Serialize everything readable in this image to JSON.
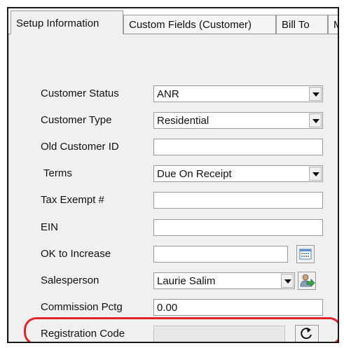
{
  "tabs": [
    {
      "label": "Setup Information",
      "active": true
    },
    {
      "label": "Custom Fields (Customer)",
      "active": false
    },
    {
      "label": "Bill To",
      "active": false
    },
    {
      "label": "Ma",
      "active": false
    }
  ],
  "form": {
    "customer_status": {
      "label": "Customer Status",
      "value": "ANR"
    },
    "customer_type": {
      "label": "Customer Type",
      "value": "Residential"
    },
    "old_customer_id": {
      "label": "Old Customer ID",
      "value": ""
    },
    "terms": {
      "label": "Terms",
      "value": "Due On Receipt"
    },
    "tax_exempt": {
      "label": "Tax Exempt #",
      "value": ""
    },
    "ein": {
      "label": "EIN",
      "value": ""
    },
    "ok_to_increase": {
      "label": "OK to Increase",
      "value": ""
    },
    "salesperson": {
      "label": "Salesperson",
      "value": "Laurie Salim"
    },
    "commission_pctg": {
      "label": "Commission Pctg",
      "value": "0.00"
    },
    "registration_code": {
      "label": "Registration Code",
      "value": ""
    }
  },
  "icons": {
    "date_picker": "calendar-icon",
    "salesperson_lookup": "person-arrow-icon",
    "refresh": "refresh-icon"
  },
  "colors": {
    "highlight": "#e1242a",
    "panel_background": "#f0f0f0"
  }
}
